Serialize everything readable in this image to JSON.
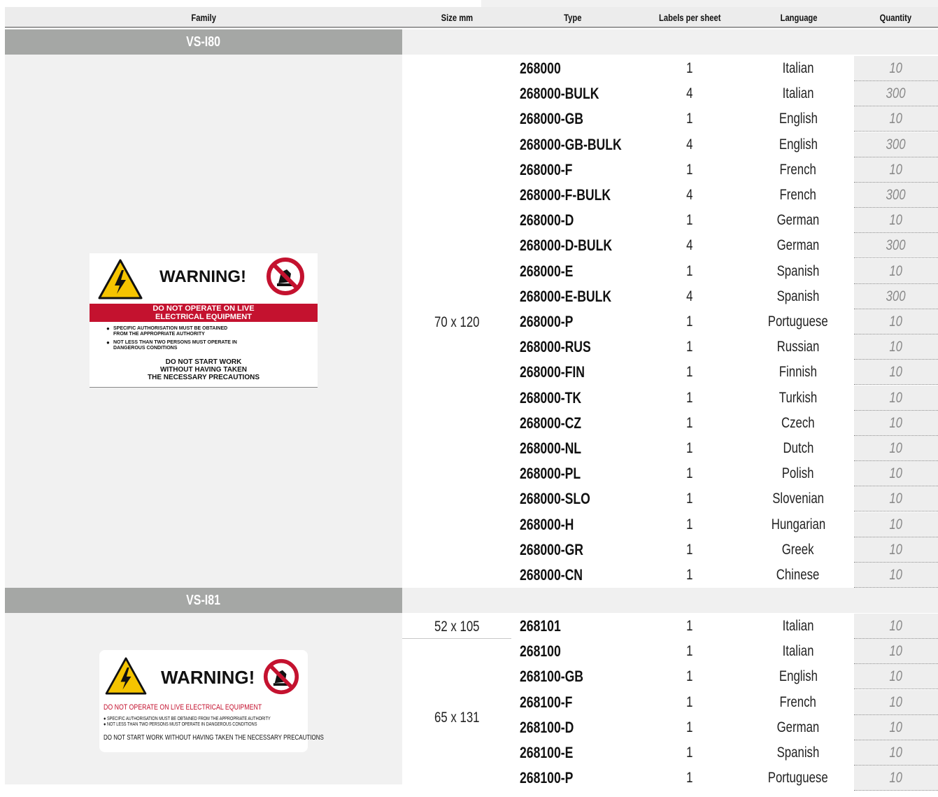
{
  "header": {
    "family": "Family",
    "size": "Size mm",
    "type": "Type",
    "labels_per_sheet": "Labels per sheet",
    "language": "Language",
    "quantity": "Quantity"
  },
  "families": [
    {
      "name": "VS-I80",
      "size_groups": [
        {
          "size": "70 x 120",
          "rows": [
            {
              "type": "268000",
              "lps": "1",
              "lang": "Italian",
              "qty": "10"
            },
            {
              "type": "268000-BULK",
              "lps": "4",
              "lang": "Italian",
              "qty": "300"
            },
            {
              "type": "268000-GB",
              "lps": "1",
              "lang": "English",
              "qty": "10"
            },
            {
              "type": "268000-GB-BULK",
              "lps": "4",
              "lang": "English",
              "qty": "300"
            },
            {
              "type": "268000-F",
              "lps": "1",
              "lang": "French",
              "qty": "10"
            },
            {
              "type": "268000-F-BULK",
              "lps": "4",
              "lang": "French",
              "qty": "300"
            },
            {
              "type": "268000-D",
              "lps": "1",
              "lang": "German",
              "qty": "10"
            },
            {
              "type": "268000-D-BULK",
              "lps": "4",
              "lang": "German",
              "qty": "300"
            },
            {
              "type": "268000-E",
              "lps": "1",
              "lang": "Spanish",
              "qty": "10"
            },
            {
              "type": "268000-E-BULK",
              "lps": "4",
              "lang": "Spanish",
              "qty": "300"
            },
            {
              "type": "268000-P",
              "lps": "1",
              "lang": "Portuguese",
              "qty": "10"
            },
            {
              "type": "268000-RUS",
              "lps": "1",
              "lang": "Russian",
              "qty": "10"
            },
            {
              "type": "268000-FIN",
              "lps": "1",
              "lang": "Finnish",
              "qty": "10"
            },
            {
              "type": "268000-TK",
              "lps": "1",
              "lang": "Turkish",
              "qty": "10"
            },
            {
              "type": "268000-CZ",
              "lps": "1",
              "lang": "Czech",
              "qty": "10"
            },
            {
              "type": "268000-NL",
              "lps": "1",
              "lang": "Dutch",
              "qty": "10"
            },
            {
              "type": "268000-PL",
              "lps": "1",
              "lang": "Polish",
              "qty": "10"
            },
            {
              "type": "268000-SLO",
              "lps": "1",
              "lang": "Slovenian",
              "qty": "10"
            },
            {
              "type": "268000-H",
              "lps": "1",
              "lang": "Hungarian",
              "qty": "10"
            },
            {
              "type": "268000-GR",
              "lps": "1",
              "lang": "Greek",
              "qty": "10"
            },
            {
              "type": "268000-CN",
              "lps": "1",
              "lang": "Chinese",
              "qty": "10"
            }
          ]
        }
      ],
      "label": {
        "title": "WARNING!",
        "bar_line1": "DO NOT OPERATE ON LIVE",
        "bar_line2": "ELECTRICAL EQUIPMENT",
        "bullet1_l1": "SPECIFIC AUTHORISATION MUST BE OBTAINED",
        "bullet1_l2": "FROM THE APPROPRIATE AUTHORITY",
        "bullet2_l1": "NOT LESS THAN TWO PERSONS MUST OPERATE IN",
        "bullet2_l2": "DANGEROUS CONDITIONS",
        "footer_l1": "DO NOT START WORK",
        "footer_l2": "WITHOUT HAVING TAKEN",
        "footer_l3": "THE NECESSARY PRECAUTIONS"
      }
    },
    {
      "name": "VS-I81",
      "size_groups": [
        {
          "size": "52 x 105",
          "rows": [
            {
              "type": "268101",
              "lps": "1",
              "lang": "Italian",
              "qty": "10"
            }
          ]
        },
        {
          "size": "65 x 131",
          "rows": [
            {
              "type": "268100",
              "lps": "1",
              "lang": "Italian",
              "qty": "10"
            },
            {
              "type": "268100-GB",
              "lps": "1",
              "lang": "English",
              "qty": "10"
            },
            {
              "type": "268100-F",
              "lps": "1",
              "lang": "French",
              "qty": "10"
            },
            {
              "type": "268100-D",
              "lps": "1",
              "lang": "German",
              "qty": "10"
            },
            {
              "type": "268100-E",
              "lps": "1",
              "lang": "Spanish",
              "qty": "10"
            },
            {
              "type": "268100-P",
              "lps": "1",
              "lang": "Portuguese",
              "qty": "10"
            }
          ]
        }
      ],
      "label": {
        "title": "WARNING!",
        "bar_line1": "DO NOT OPERATE ON LIVE ELECTRICAL EQUIPMENT",
        "bullet1_l1": "SPECIFIC AUTHORISATION MUST BE OBTAINED FROM THE APPROPRIATE AUTHORITY",
        "bullet2_l1": "NOT LESS THAN TWO PERSONS MUST OPERATE IN DANGEROUS CONDITIONS",
        "footer_l1": "DO NOT START WORK WITHOUT HAVING TAKEN THE NECESSARY PRECAUTIONS"
      }
    }
  ],
  "colors": {
    "family_bar": "#a5a7a5",
    "label_red": "#c4122f",
    "warning_yellow": "#f5c400",
    "quantity_text": "#8a8a8a"
  },
  "icons": [
    "high-voltage-warning-icon",
    "no-touch-prohibition-icon"
  ]
}
